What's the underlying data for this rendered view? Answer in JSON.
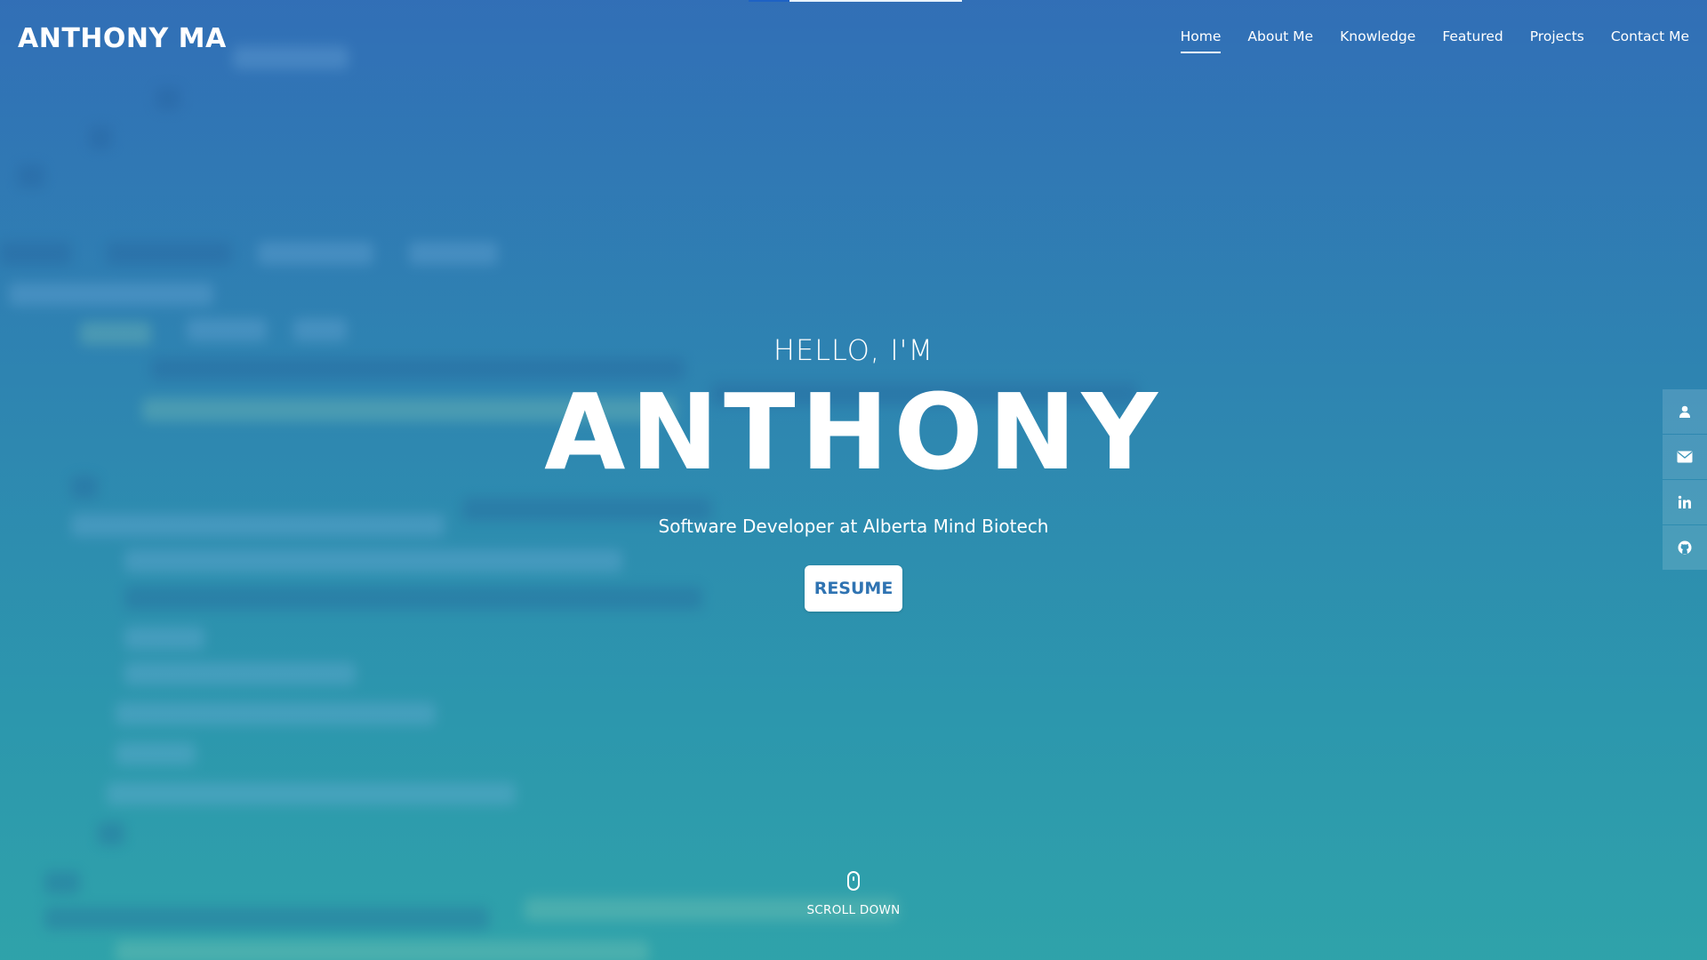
{
  "header": {
    "brand": "ANTHONY MA",
    "nav": [
      {
        "label": "Home",
        "active": true
      },
      {
        "label": "About Me",
        "active": false
      },
      {
        "label": "Knowledge",
        "active": false
      },
      {
        "label": "Featured",
        "active": false
      },
      {
        "label": "Projects",
        "active": false
      },
      {
        "label": "Contact Me",
        "active": false
      }
    ]
  },
  "hero": {
    "greeting": "HELLO, I'M",
    "name": "ANTHONY",
    "tagline": "Software Developer at Alberta Mind Biotech",
    "resume_label": "RESUME"
  },
  "side_social": {
    "items": [
      {
        "icon": "user-icon"
      },
      {
        "icon": "envelope-icon"
      },
      {
        "icon": "linkedin-icon"
      },
      {
        "icon": "github-icon"
      }
    ]
  },
  "scroll": {
    "label": "SCROLL DOWN",
    "icon": "mouse-icon"
  },
  "colors": {
    "gradient_top": "#3371b7",
    "gradient_bottom": "#30a3aa",
    "resume_text": "#2f73b2"
  }
}
